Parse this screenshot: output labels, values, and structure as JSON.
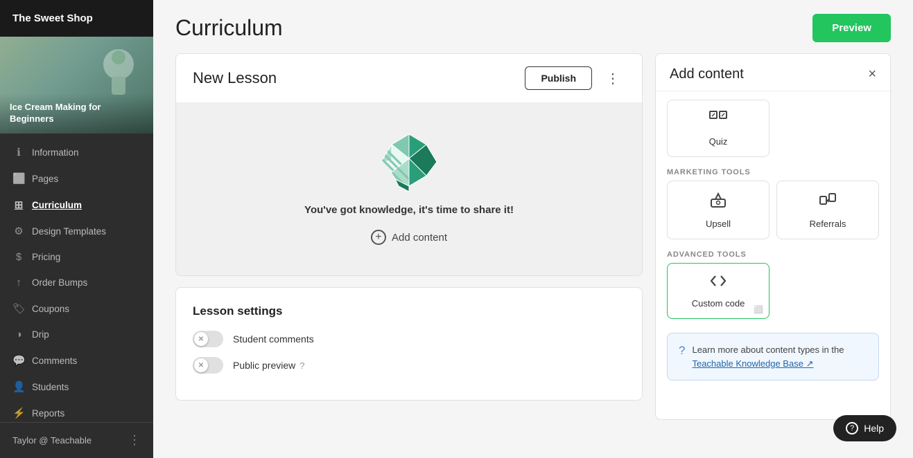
{
  "sidebar": {
    "school_name": "The Sweet Shop",
    "course_title": "Ice Cream Making for Beginners",
    "nav_items": [
      {
        "id": "information",
        "label": "Information",
        "icon": "ℹ"
      },
      {
        "id": "pages",
        "label": "Pages",
        "icon": "📄"
      },
      {
        "id": "curriculum",
        "label": "Curriculum",
        "icon": "📚",
        "active": true
      },
      {
        "id": "design-templates",
        "label": "Design Templates",
        "icon": "🎨"
      },
      {
        "id": "pricing",
        "label": "Pricing",
        "icon": "💲"
      },
      {
        "id": "order-bumps",
        "label": "Order Bumps",
        "icon": "⬆"
      },
      {
        "id": "coupons",
        "label": "Coupons",
        "icon": "🏷"
      },
      {
        "id": "drip",
        "label": "Drip",
        "icon": "💧"
      },
      {
        "id": "comments",
        "label": "Comments",
        "icon": "💬"
      },
      {
        "id": "students",
        "label": "Students",
        "icon": "👤"
      },
      {
        "id": "reports",
        "label": "Reports",
        "icon": "📊"
      }
    ],
    "footer_user": "Taylor @ Teachable"
  },
  "main": {
    "title": "Curriculum",
    "preview_btn": "Preview",
    "lesson": {
      "title": "New Lesson",
      "publish_btn": "Publish",
      "empty_text": "You've got knowledge, it's time to share it!",
      "add_content_btn": "Add content"
    },
    "lesson_settings": {
      "title": "Lesson settings",
      "student_comments_label": "Student comments",
      "public_preview_label": "Public preview"
    }
  },
  "add_content_panel": {
    "title": "Add content",
    "close_btn": "×",
    "sections": {
      "marketing_tools": "Marketing Tools",
      "advanced_tools": "Advanced Tools"
    },
    "tiles": [
      {
        "id": "quiz",
        "label": "Quiz",
        "icon": "quiz"
      }
    ],
    "marketing_tiles": [
      {
        "id": "upsell",
        "label": "Upsell",
        "icon": "upsell"
      },
      {
        "id": "referrals",
        "label": "Referrals",
        "icon": "referrals"
      }
    ],
    "advanced_tiles": [
      {
        "id": "custom-code",
        "label": "Custom code",
        "icon": "code",
        "selected": true
      }
    ],
    "info_text": "Learn more about content types in the ",
    "info_link": "Teachable Knowledge Base",
    "info_link_ext": true
  },
  "help_btn": "Help"
}
